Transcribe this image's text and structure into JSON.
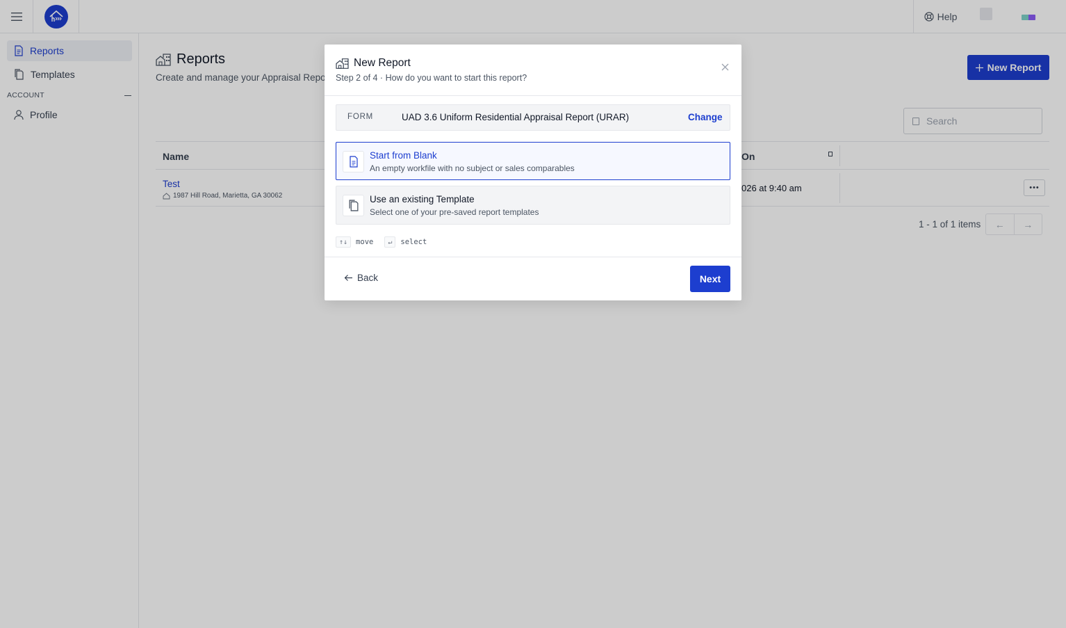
{
  "app": {
    "help_label": "Help"
  },
  "sidebar": {
    "items": [
      {
        "label": "Reports"
      },
      {
        "label": "Templates"
      }
    ],
    "section_label": "ACCOUNT",
    "account_items": [
      {
        "label": "Profile"
      }
    ]
  },
  "page": {
    "title": "Reports",
    "subtitle": "Create and manage your Appraisal Reports",
    "new_report_label": "New Report",
    "search_placeholder": "Search"
  },
  "table": {
    "columns": {
      "name": "Name",
      "on": "On"
    },
    "rows": [
      {
        "name": "Test",
        "address": "1987 Hill Road, Marietta, GA 30062",
        "date": "026 at 9:40 am"
      }
    ],
    "pagination": "1 - 1 of 1 items"
  },
  "modal": {
    "title": "New Report",
    "subtitle": "Step 2 of 4 · How do you want to start this report?",
    "form_label": "FORM",
    "form_value": "UAD 3.6 Uniform Residential Appraisal Report (URAR)",
    "change_label": "Change",
    "options": [
      {
        "title": "Start from Blank",
        "description": "An empty workfile with no subject or sales comparables",
        "selected": true
      },
      {
        "title": "Use an existing Template",
        "description": "Select one of your pre-saved report templates",
        "selected": false
      }
    ],
    "hints": [
      {
        "key": "↑↓",
        "label": "move"
      },
      {
        "key": "↵",
        "label": "select"
      }
    ],
    "back_label": "Back",
    "next_label": "Next"
  },
  "colors": {
    "brand": "#1d3ecf",
    "overlay": "rgba(0,0,0,0.2)"
  }
}
